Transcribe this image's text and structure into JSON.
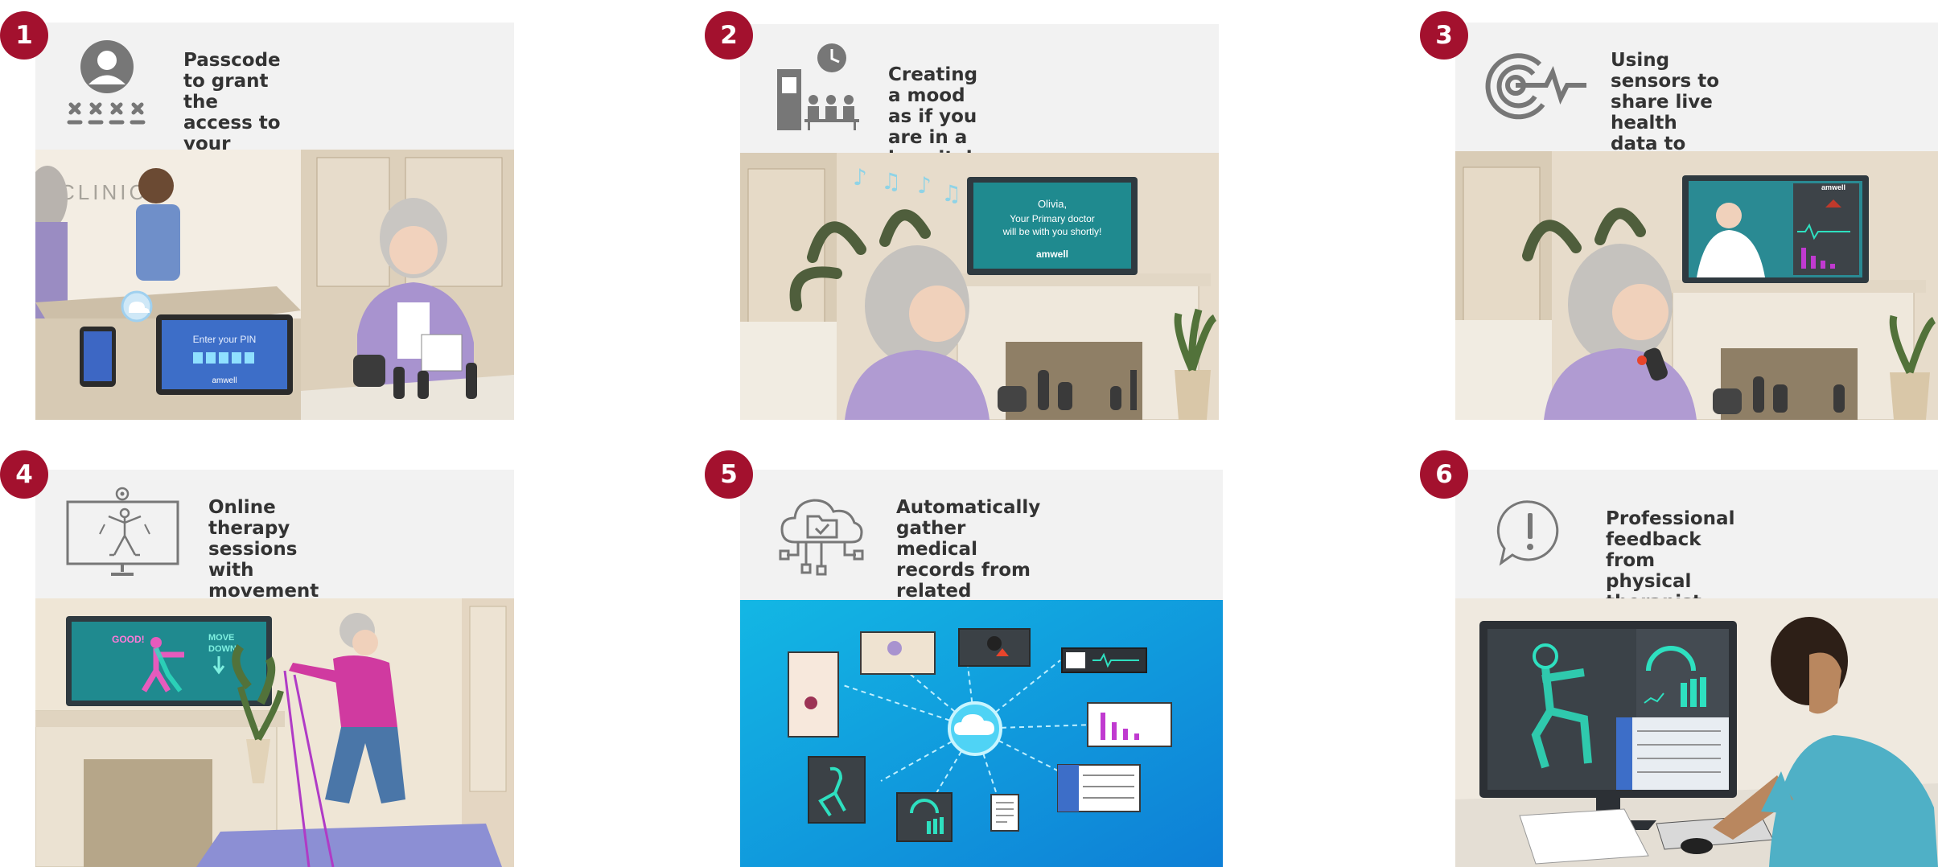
{
  "colors": {
    "badge": "#a3112e",
    "header_bg": "#f2f2f2",
    "title_text": "#333333"
  },
  "steps": [
    {
      "number": "1",
      "title": "Passcode to grant the access to\nyour medical records and instant\nsetup",
      "icon": "user-passcode-icon",
      "scene": {
        "wall_sign": "CLINIC",
        "screen_prompt": "Enter your PIN",
        "brand": "amwell"
      }
    },
    {
      "number": "2",
      "title": "Creating a mood as if you are in a\nhospital / doctor’s office",
      "icon": "waiting-room-clock-icon",
      "scene": {
        "tv_line1": "Olivia,",
        "tv_line2": "Your Primary doctor",
        "tv_line3": "will be with you shortly!",
        "brand": "amwell"
      }
    },
    {
      "number": "3",
      "title": "Using sensors to share live health\ndata to communicate clearly with\nyour primary doctor",
      "icon": "sensor-pulse-target-icon",
      "scene": {
        "brand": "amwell"
      }
    },
    {
      "number": "4",
      "title": "Online therapy sessions with\nmovement tracking sensor to\nprovide posture feedback",
      "icon": "motion-tracking-screen-icon",
      "scene": {
        "tv_good": "GOOD!",
        "tv_move": "MOVE",
        "tv_down": "DOWN"
      }
    },
    {
      "number": "5",
      "title": "Automatically gather medical\nrecords from related services,\nclinics, hospitals, pharmacy",
      "icon": "cloud-records-network-icon",
      "scene": {}
    },
    {
      "number": "6",
      "title": "Professional feedback from\nphysical therapist",
      "icon": "alert-speech-bubble-icon",
      "scene": {}
    }
  ]
}
